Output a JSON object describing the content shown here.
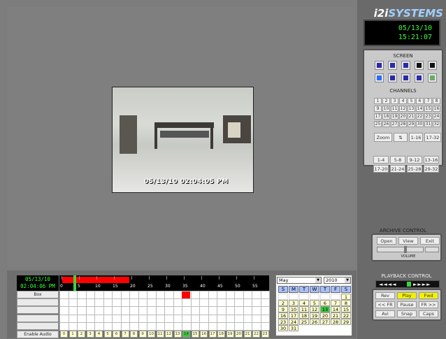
{
  "brand": {
    "prefix": "i2i",
    "name": "SYSTEMS"
  },
  "clock": {
    "date": "05/13/10",
    "time": "15:21:07"
  },
  "video": {
    "timestamp": "05/13/10 02:04:05 PM"
  },
  "screen_panel": {
    "title": "SCREEN",
    "layouts": [
      "layout-4x4-icon",
      "layout-3x3-icon",
      "layout-2x2-icon",
      "layout-1x1-icon",
      "layout-single-icon",
      "layout-pip-icon",
      "layout-1plus5-icon",
      "layout-1plus7-icon",
      "layout-quad-icon",
      "layout-full-icon"
    ]
  },
  "channels_panel": {
    "title": "CHANNELS",
    "channels": [
      "1",
      "2",
      "3",
      "4",
      "5",
      "6",
      "7",
      "8",
      "9",
      "10",
      "11",
      "12",
      "13",
      "14",
      "15",
      "16",
      "17",
      "18",
      "19",
      "20",
      "21",
      "22",
      "23",
      "24",
      "25",
      "26",
      "27",
      "28",
      "29",
      "30",
      "31",
      "32"
    ],
    "zoom_label": "Zoom",
    "swap_symbol": "⇅",
    "range1": "1-16",
    "range2": "17-32"
  },
  "groups": [
    "1-4",
    "5-8",
    "9-12",
    "13-16",
    "17-20",
    "21-24",
    "25-28",
    "29-32"
  ],
  "archive": {
    "title": "ARCHIVE CONTROL",
    "open": "Open",
    "view": "View",
    "exit": "Exit",
    "volume": "VOLUME",
    "volume_level": 0.6
  },
  "playback": {
    "title": "PLAYBACK CONTROL",
    "rev": "Rev",
    "play": "Play",
    "fwd": "Fwd",
    "fr_back": "<< FR",
    "pause": "Pause",
    "fr_fwd": "FR >>",
    "avi": "Avi",
    "snap": "Snap",
    "caps": "Caps",
    "accent": "#f2f200"
  },
  "timeline": {
    "date": "05/13/10",
    "time": "02:04:06 PM",
    "ticks": [
      "0",
      "5",
      "10",
      "15",
      "20",
      "25",
      "30",
      "35",
      "40",
      "45",
      "50",
      "55"
    ],
    "row_labels": [
      "Box",
      "",
      "",
      "",
      ""
    ],
    "enable_audio": "Enable Audio",
    "hours": [
      "0",
      "1",
      "2",
      "3",
      "4",
      "5",
      "6",
      "7",
      "8",
      "9",
      "10",
      "11",
      "12",
      "13",
      "14",
      "15",
      "16",
      "17",
      "18",
      "19",
      "20",
      "21",
      "22",
      "23"
    ],
    "selected_hour": "14"
  },
  "calendar": {
    "month": "May",
    "year": "2010",
    "weekdays": [
      "S",
      "M",
      "T",
      "W",
      "T",
      "F",
      "S"
    ],
    "days": [
      "",
      "",
      "",
      "",
      "",
      "",
      "1",
      "2",
      "3",
      "4",
      "5",
      "6",
      "7",
      "8",
      "9",
      "10",
      "11",
      "12",
      "13",
      "14",
      "15",
      "16",
      "17",
      "18",
      "19",
      "20",
      "21",
      "22",
      "23",
      "24",
      "25",
      "26",
      "27",
      "28",
      "29",
      "30",
      "31"
    ],
    "selected_day": "13"
  }
}
